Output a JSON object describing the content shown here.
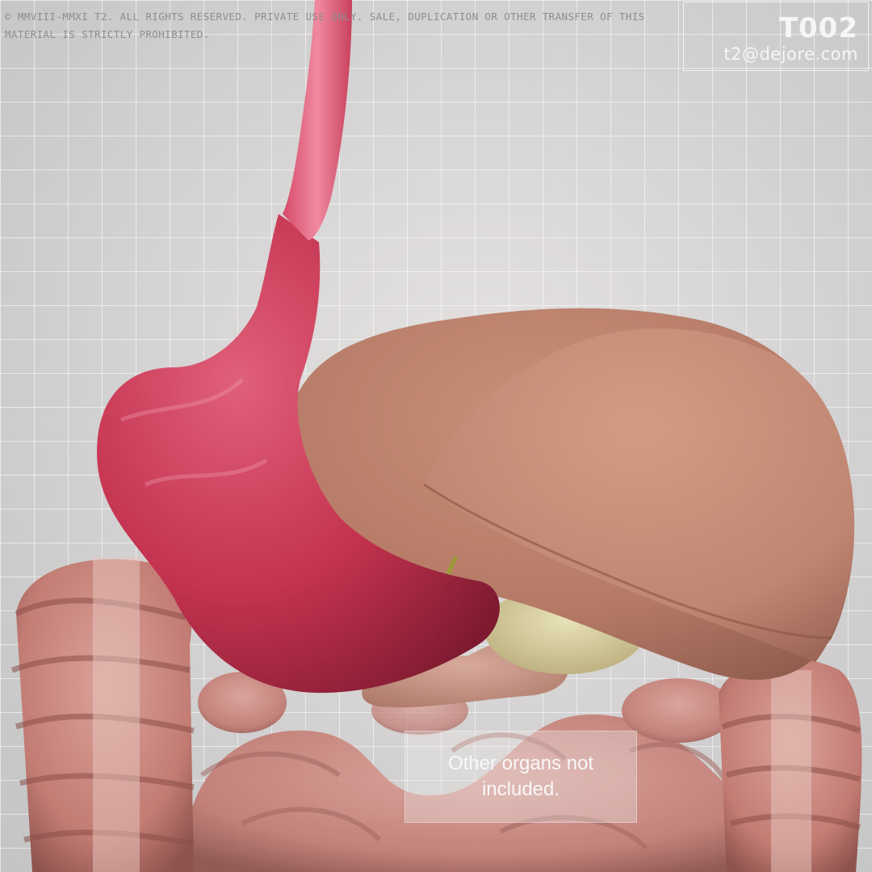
{
  "watermark": {
    "copyright": "© MMVIII-MMXI T2. ALL RIGHTS RESERVED. PRIVATE USE ONLY. SALE, DUPLICATION OR OTHER TRANSFER OF THIS MATERIAL IS STRICTLY PROHIBITED.",
    "product_code": "T002",
    "email": "t2@dejore.com"
  },
  "caption": "Other organs not included.",
  "colors": {
    "background": "#d6d4d4",
    "grid": "#ffffff",
    "esophagus": "#e2607a",
    "stomach": "#c8324e",
    "liver": "#c48a72",
    "intestine": "#c98a80",
    "gallbladder": "#d8d0a0",
    "pancreas": "#c9968a"
  },
  "scene_parts": [
    "esophagus",
    "stomach",
    "liver",
    "gallbladder",
    "bile-duct",
    "pancreas",
    "large-intestine",
    "small-intestine"
  ]
}
